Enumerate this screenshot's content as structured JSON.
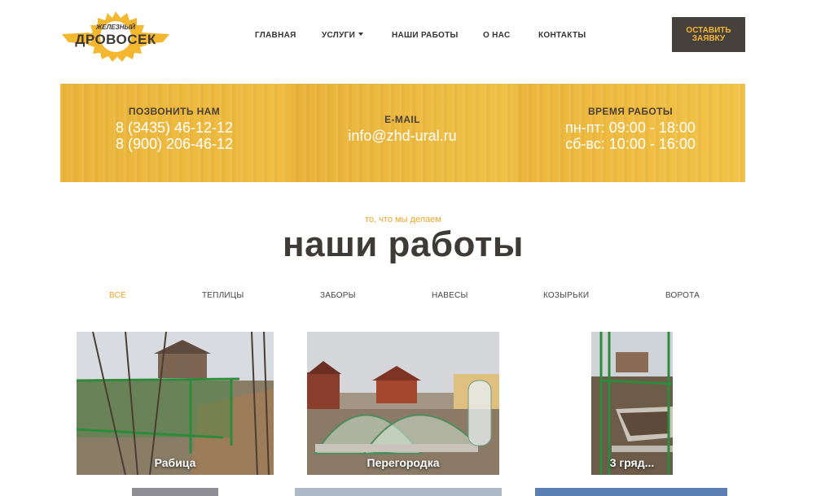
{
  "brand": {
    "line1": "ЖЕЛЕЗНЫЙ",
    "line2": "ДРОВОСЕК",
    "accent": "#f4b730"
  },
  "nav": {
    "items": [
      "ГЛАВНАЯ",
      "УСЛУГИ",
      "НАШИ РАБОТЫ",
      "О НАС",
      "КОНТАКТЫ"
    ],
    "cta_line1": "ОСТАВИТЬ",
    "cta_line2": "ЗАЯВКУ"
  },
  "contacts": {
    "phone_label": "ПОЗВОНИТЬ НАМ",
    "phone1": "8 (3435) 46-12-12",
    "phone2": "8 (900) 206-46-12",
    "email_label": "E-MAIL",
    "email": "info@zhd-ural.ru",
    "hours_label": "ВРЕМЯ РАБОТЫ",
    "hours1": "пн-пт: 09:00 - 18:00",
    "hours2": "сб-вс: 10:00 - 16:00"
  },
  "works": {
    "eyebrow": "то, что мы делаем",
    "title": "наши работы",
    "filters": [
      "ВСЕ",
      "ТЕПЛИЦЫ",
      "ЗАБОРЫ",
      "НАВЕСЫ",
      "КОЗЫРЬКИ",
      "ВОРОТА"
    ],
    "active_filter": "ВСЕ",
    "items": [
      {
        "caption": "Рабица"
      },
      {
        "caption": "Перегородка"
      },
      {
        "caption": "3 гряд..."
      }
    ]
  },
  "colors": {
    "dark": "#46413c",
    "orange": "#eea62a",
    "yellow": "#f0bd42"
  }
}
